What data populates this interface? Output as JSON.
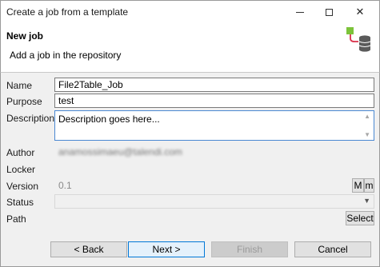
{
  "window": {
    "title": "Create a job from a template",
    "minimize_icon": "minimize-icon",
    "maximize_icon": "maximize-icon",
    "close_glyph": "✕"
  },
  "header": {
    "title": "New job",
    "description": "Add a job in the repository",
    "icon": "job-database-icon"
  },
  "form": {
    "name_label": "Name",
    "name_value": "File2Table_Job",
    "purpose_label": "Purpose",
    "purpose_value": "test",
    "description_label": "Description",
    "description_value": "Description goes here...",
    "author_label": "Author",
    "author_value": "anamossimaeu@talendi.com",
    "locker_label": "Locker",
    "locker_value": "",
    "version_label": "Version",
    "version_value": "0.1",
    "version_major_button": "M",
    "version_minor_button": "m",
    "status_label": "Status",
    "status_value": "",
    "path_label": "Path",
    "path_value": "",
    "path_select_button": "Select"
  },
  "footer": {
    "back": "< Back",
    "next": "Next >",
    "finish": "Finish",
    "cancel": "Cancel"
  },
  "colors": {
    "focus_border": "#4a88d2",
    "default_button_border": "#0078d7",
    "icon_green": "#7cc33a",
    "icon_red": "#d9304a",
    "icon_db": "#5a5a5a"
  }
}
